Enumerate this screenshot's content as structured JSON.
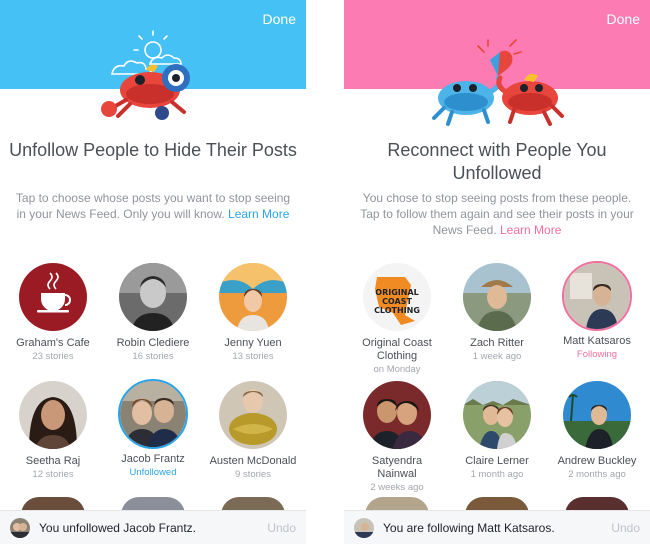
{
  "colors": {
    "left_header": "#46c1f5",
    "right_header": "#fd7bb3",
    "link_blue": "#2aa4e9",
    "link_pink": "#f26e9d"
  },
  "left": {
    "done_label": "Done",
    "title": "Unfollow People to Hide Their Posts",
    "desc": "Tap to choose whose posts you want to stop seeing in your News Feed. Only you will know.",
    "learn_more": "Learn More",
    "people": [
      {
        "name": "Graham's Cafe",
        "meta": "23 stories"
      },
      {
        "name": "Robin Clediere",
        "meta": "16 stories"
      },
      {
        "name": "Jenny Yuen",
        "meta": "13 stories"
      },
      {
        "name": "Seetha Raj",
        "meta": "12 stories"
      },
      {
        "name": "Jacob Frantz",
        "meta": "Unfollowed",
        "selected": true
      },
      {
        "name": "Austen McDonald",
        "meta": "9 stories"
      }
    ],
    "toast": {
      "text": "You unfollowed Jacob Frantz.",
      "undo": "Undo"
    }
  },
  "right": {
    "done_label": "Done",
    "title": "Reconnect with People You Unfollowed",
    "desc": "You chose to stop seeing posts from these people. Tap to follow them again and see their posts in your News Feed.",
    "learn_more": "Learn More",
    "logo_text": "ORIGINAL COAST CLOTHING",
    "people": [
      {
        "name": "Original Coast Clothing",
        "meta": "on Monday"
      },
      {
        "name": "Zach Ritter",
        "meta": "1 week ago"
      },
      {
        "name": "Matt Katsaros",
        "meta": "Following",
        "selected": true
      },
      {
        "name": "Satyendra Nainwal",
        "meta": "2 weeks ago"
      },
      {
        "name": "Claire Lerner",
        "meta": "1 month ago"
      },
      {
        "name": "Andrew Buckley",
        "meta": "2 months ago"
      }
    ],
    "toast": {
      "text": "You are following Matt Katsaros.",
      "undo": "Undo"
    }
  }
}
